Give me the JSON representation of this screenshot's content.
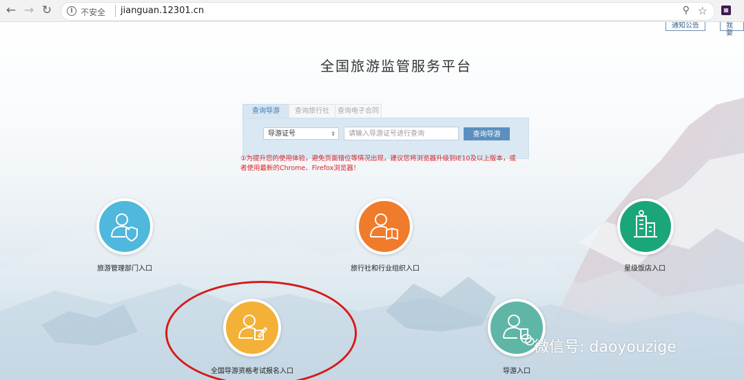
{
  "browser": {
    "security_label": "不安全",
    "url": "jianguan.12301.cn",
    "icons": [
      "back-icon",
      "forward-icon",
      "reload-icon",
      "info-icon",
      "zoom-icon",
      "star-icon",
      "extension-icon"
    ]
  },
  "top_links": [
    "通知公告",
    "我要"
  ],
  "page_title": "全国旅游监管服务平台",
  "search": {
    "tabs": [
      "查询导游",
      "查询旅行社",
      "查询电子合同"
    ],
    "select_value": "导游证号",
    "input_placeholder": "请输入导游证号进行查询",
    "button_label": "查询导游"
  },
  "notice": "①为提升您的使用体验，避免页面错位等情况出现，建议您将浏览器升级到IE10及以上版本，或者使用最新的Chrome、Firefox浏览器！",
  "entries": [
    {
      "label": "旅游管理部门入口",
      "color": "#4fb8dc"
    },
    {
      "label": "旅行社和行业组织入口",
      "color": "#f07b2a"
    },
    {
      "label": "星级饭店入口",
      "color": "#1ba67a"
    },
    {
      "label": "全国导游资格考试报名入口",
      "color": "#f3b138"
    },
    {
      "label": "导游入口",
      "color": "#5fb6a6"
    }
  ],
  "watermark": "微信号: daoyouzige"
}
